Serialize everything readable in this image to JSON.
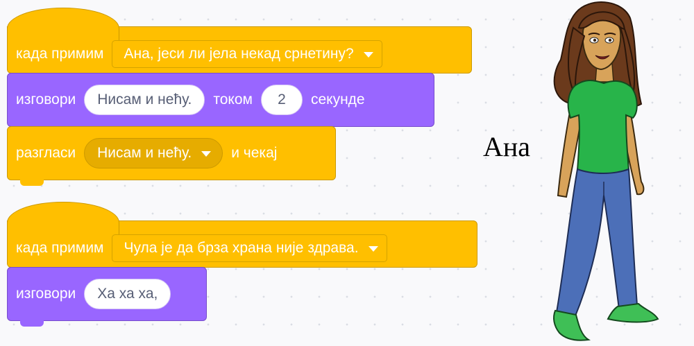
{
  "script1": {
    "hat": {
      "label": "када примим",
      "message": "Ана, јеси ли јела некад срнетину?"
    },
    "say": {
      "label": "изговори",
      "text": "Нисам и нећу.",
      "for_label": "током",
      "secs": "2",
      "secs_label": "секунде"
    },
    "broadcast": {
      "label": "разгласи",
      "message": "Нисам и нећу.",
      "wait_label": "и чекај"
    }
  },
  "script2": {
    "hat": {
      "label": "када примим",
      "message": "Чула је да брза храна није здрава."
    },
    "say": {
      "label": "изговори",
      "text": "Ха ха ха,"
    }
  },
  "sprite": {
    "name": "Ана"
  },
  "colors": {
    "events": "#ffbf00",
    "looks": "#9966ff",
    "hair": "#6b3a1c",
    "skin": "#d8a35a",
    "shirt": "#28b44a",
    "jeans": "#4c6fb8",
    "shoes": "#3fbf56"
  }
}
